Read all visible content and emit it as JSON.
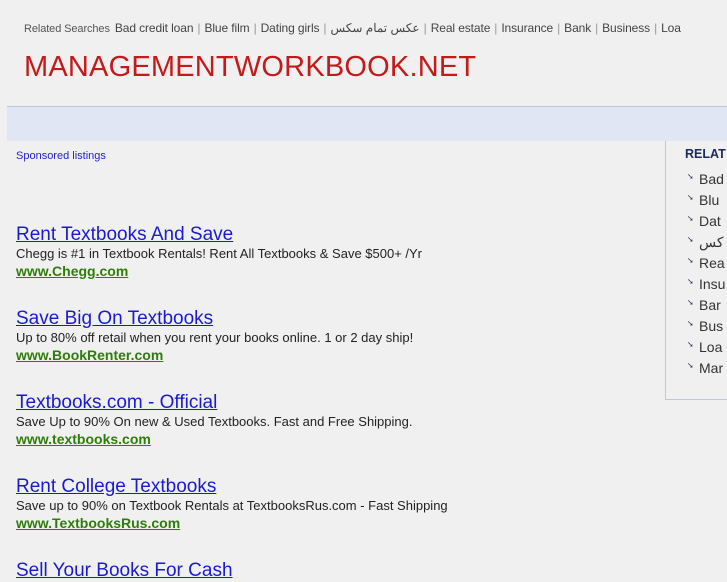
{
  "top": {
    "label": "Related Searches",
    "links": [
      "Bad credit loan",
      "Blue film",
      "Dating girls",
      "عكس تمام سكس",
      "Real estate",
      "Insurance",
      "Bank",
      "Business",
      "Loa"
    ]
  },
  "logo": "MANAGEMENTWORKBOOK.NET",
  "sponsored": "Sponsored listings",
  "ads": [
    {
      "title": "Rent Textbooks And Save",
      "desc": "Chegg is #1 in Textbook Rentals! Rent All Textbooks & Save $500+ /Yr",
      "url": "www.Chegg.com"
    },
    {
      "title": "Save Big On Textbooks",
      "desc": "Up to 80% off retail when you rent your books online. 1 or 2 day ship!",
      "url": "www.BookRenter.com"
    },
    {
      "title": "Textbooks.com - Official",
      "desc": "Save Up to 90% On new & Used Textbooks. Fast and Free Shipping.",
      "url": "www.textbooks.com"
    },
    {
      "title": "Rent College Textbooks",
      "desc": "Save up to 90% on Textbook Rentals at TextbooksRus.com - Fast Shipping",
      "url": "www.TextbooksRus.com"
    },
    {
      "title": "Sell Your Books For Cash",
      "desc": "",
      "url": ""
    }
  ],
  "sidebar": {
    "title": "RELAT",
    "items": [
      "Bad",
      "Blu",
      "Dat",
      "كس",
      "Rea",
      "Insu",
      "Bar",
      "Bus",
      "Loa",
      "Mar"
    ]
  }
}
